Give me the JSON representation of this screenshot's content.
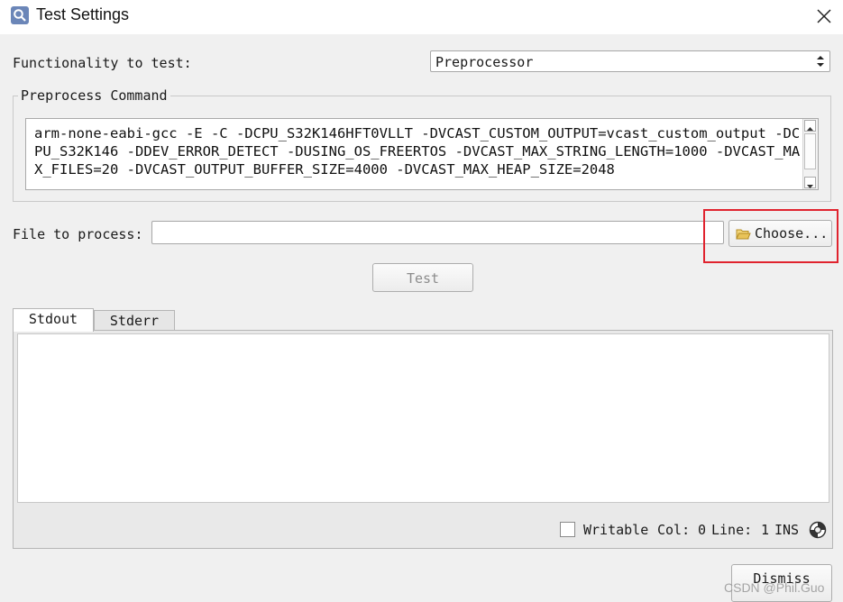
{
  "window": {
    "title": "Test Settings"
  },
  "functionality": {
    "label": "Functionality to test:",
    "selected": "Preprocessor"
  },
  "preprocess": {
    "group_title": "Preprocess Command",
    "command": "arm-none-eabi-gcc -E -C -DCPU_S32K146HFT0VLLT -DVCAST_CUSTOM_OUTPUT=vcast_custom_output -DCPU_S32K146 -DDEV_ERROR_DETECT -DUSING_OS_FREERTOS -DVCAST_MAX_STRING_LENGTH=1000 -DVCAST_MAX_FILES=20 -DVCAST_OUTPUT_BUFFER_SIZE=4000 -DVCAST_MAX_HEAP_SIZE=2048"
  },
  "file": {
    "label": "File to process:",
    "value": "",
    "choose_label": "Choose..."
  },
  "test_button": "Test",
  "tabs": [
    {
      "label": "Stdout",
      "active": true
    },
    {
      "label": "Stderr",
      "active": false
    }
  ],
  "statusbar": {
    "writable": "Writable",
    "col_label": "Col:",
    "col": "0",
    "line_label": "Line:",
    "line": "1",
    "mode": "INS"
  },
  "dismiss_button": "Dismiss",
  "watermark": "CSDN @Phil.Guo",
  "colors": {
    "highlight": "#e0232e",
    "icon": "#6b86b8",
    "folder": "#e8c35a"
  }
}
